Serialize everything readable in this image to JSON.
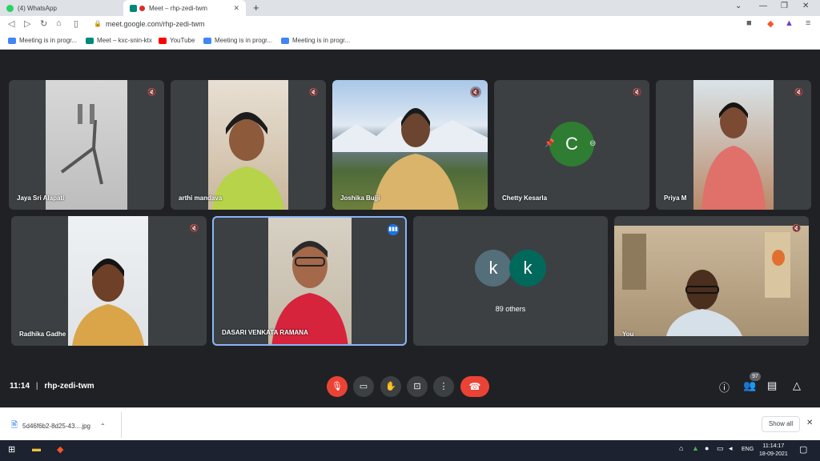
{
  "tabs": [
    {
      "title": "(4) WhatsApp"
    },
    {
      "title": "Meet – rhp-zedi-twm"
    }
  ],
  "address_bar": {
    "url": "meet.google.com/rhp-zedi-twm"
  },
  "bookmarks": [
    {
      "label": "Meeting is in progr...",
      "color": "#4285f4"
    },
    {
      "label": "Meet – kxc-snin-ktx",
      "color": "#00897b"
    },
    {
      "label": "YouTube",
      "color": "#ff0000"
    },
    {
      "label": "Meeting is in progr...",
      "color": "#4285f4"
    },
    {
      "label": "Meeting is in progr...",
      "color": "#4285f4"
    }
  ],
  "participants": [
    {
      "name": "Jaya Sri Alapati",
      "muted": true
    },
    {
      "name": "arthi mandava",
      "muted": true
    },
    {
      "name": "Joshika Bujji",
      "muted": true
    },
    {
      "name": "Chetty Kesarla",
      "muted": true,
      "avatar_letter": "C",
      "avatar_color": "#2e7d32"
    },
    {
      "name": "Priya M",
      "muted": true
    },
    {
      "name": "Radhika Gadhe",
      "muted": true
    },
    {
      "name": "DASARI VENKATA RAMANA",
      "speaking": true
    },
    {
      "name": "You",
      "muted": true
    }
  ],
  "others_tile": {
    "label": "89 others",
    "avatars": [
      "k",
      "k"
    ]
  },
  "meeting": {
    "time": "11:14",
    "code": "rhp-zedi-twm",
    "participant_count": "97"
  },
  "downloads": {
    "file": "5d46f6b2-8d25-43....jpg",
    "show_all": "Show all"
  },
  "taskbar": {
    "lang": "ENG",
    "time": "11:14:17",
    "date": "18-09-2021"
  }
}
